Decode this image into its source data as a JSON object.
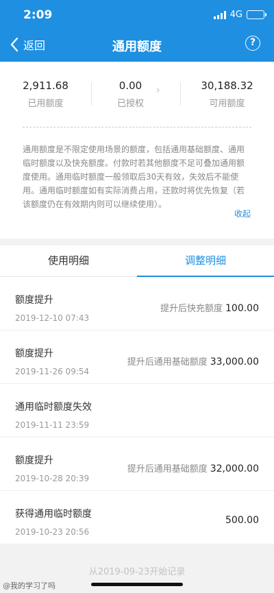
{
  "status_bar": {
    "time": "2:09",
    "network": "4G"
  },
  "nav": {
    "back_label": "返回",
    "title": "通用额度",
    "help_icon": "?"
  },
  "summary": {
    "stats": [
      {
        "value": "2,911.68",
        "label": "已用额度"
      },
      {
        "value": "0.00",
        "label": "已授权"
      },
      {
        "value": "30,188.32",
        "label": "可用额度"
      }
    ],
    "description": "通用额度是不限定使用场景的额度，包括通用基础额度、通用临时额度以及快充额度。付款时若其他额度不足可叠加通用额度使用。通用临时额度一般领取后30天有效，失效后不能使用。通用临时额度如有实际消费占用，还款时将优先恢复（若该额度仍在有效期内则可以继续使用）。",
    "collapse_label": "收起"
  },
  "tabs": [
    {
      "label": "使用明细",
      "active": false
    },
    {
      "label": "调整明细",
      "active": true
    }
  ],
  "records": [
    {
      "title": "额度提升",
      "date": "2019-12-10 07:43",
      "prefix": "提升后快充额度",
      "amount": "100.00"
    },
    {
      "title": "额度提升",
      "date": "2019-11-26 09:54",
      "prefix": "提升后通用基础额度",
      "amount": "33,000.00"
    },
    {
      "title": "通用临时额度失效",
      "date": "2019-11-11 23:59",
      "prefix": "",
      "amount": ""
    },
    {
      "title": "额度提升",
      "date": "2019-10-28 20:39",
      "prefix": "提升后通用基础额度",
      "amount": "32,000.00"
    },
    {
      "title": "获得通用临时额度",
      "date": "2019-10-23 20:56",
      "prefix": "",
      "amount": "500.00"
    }
  ],
  "footer": "从2019-09-23开始记录",
  "watermark": "@我的学习了吗",
  "colors": {
    "brand_blue": "#1e8fe1",
    "battery_yellow": "#ffd200"
  }
}
